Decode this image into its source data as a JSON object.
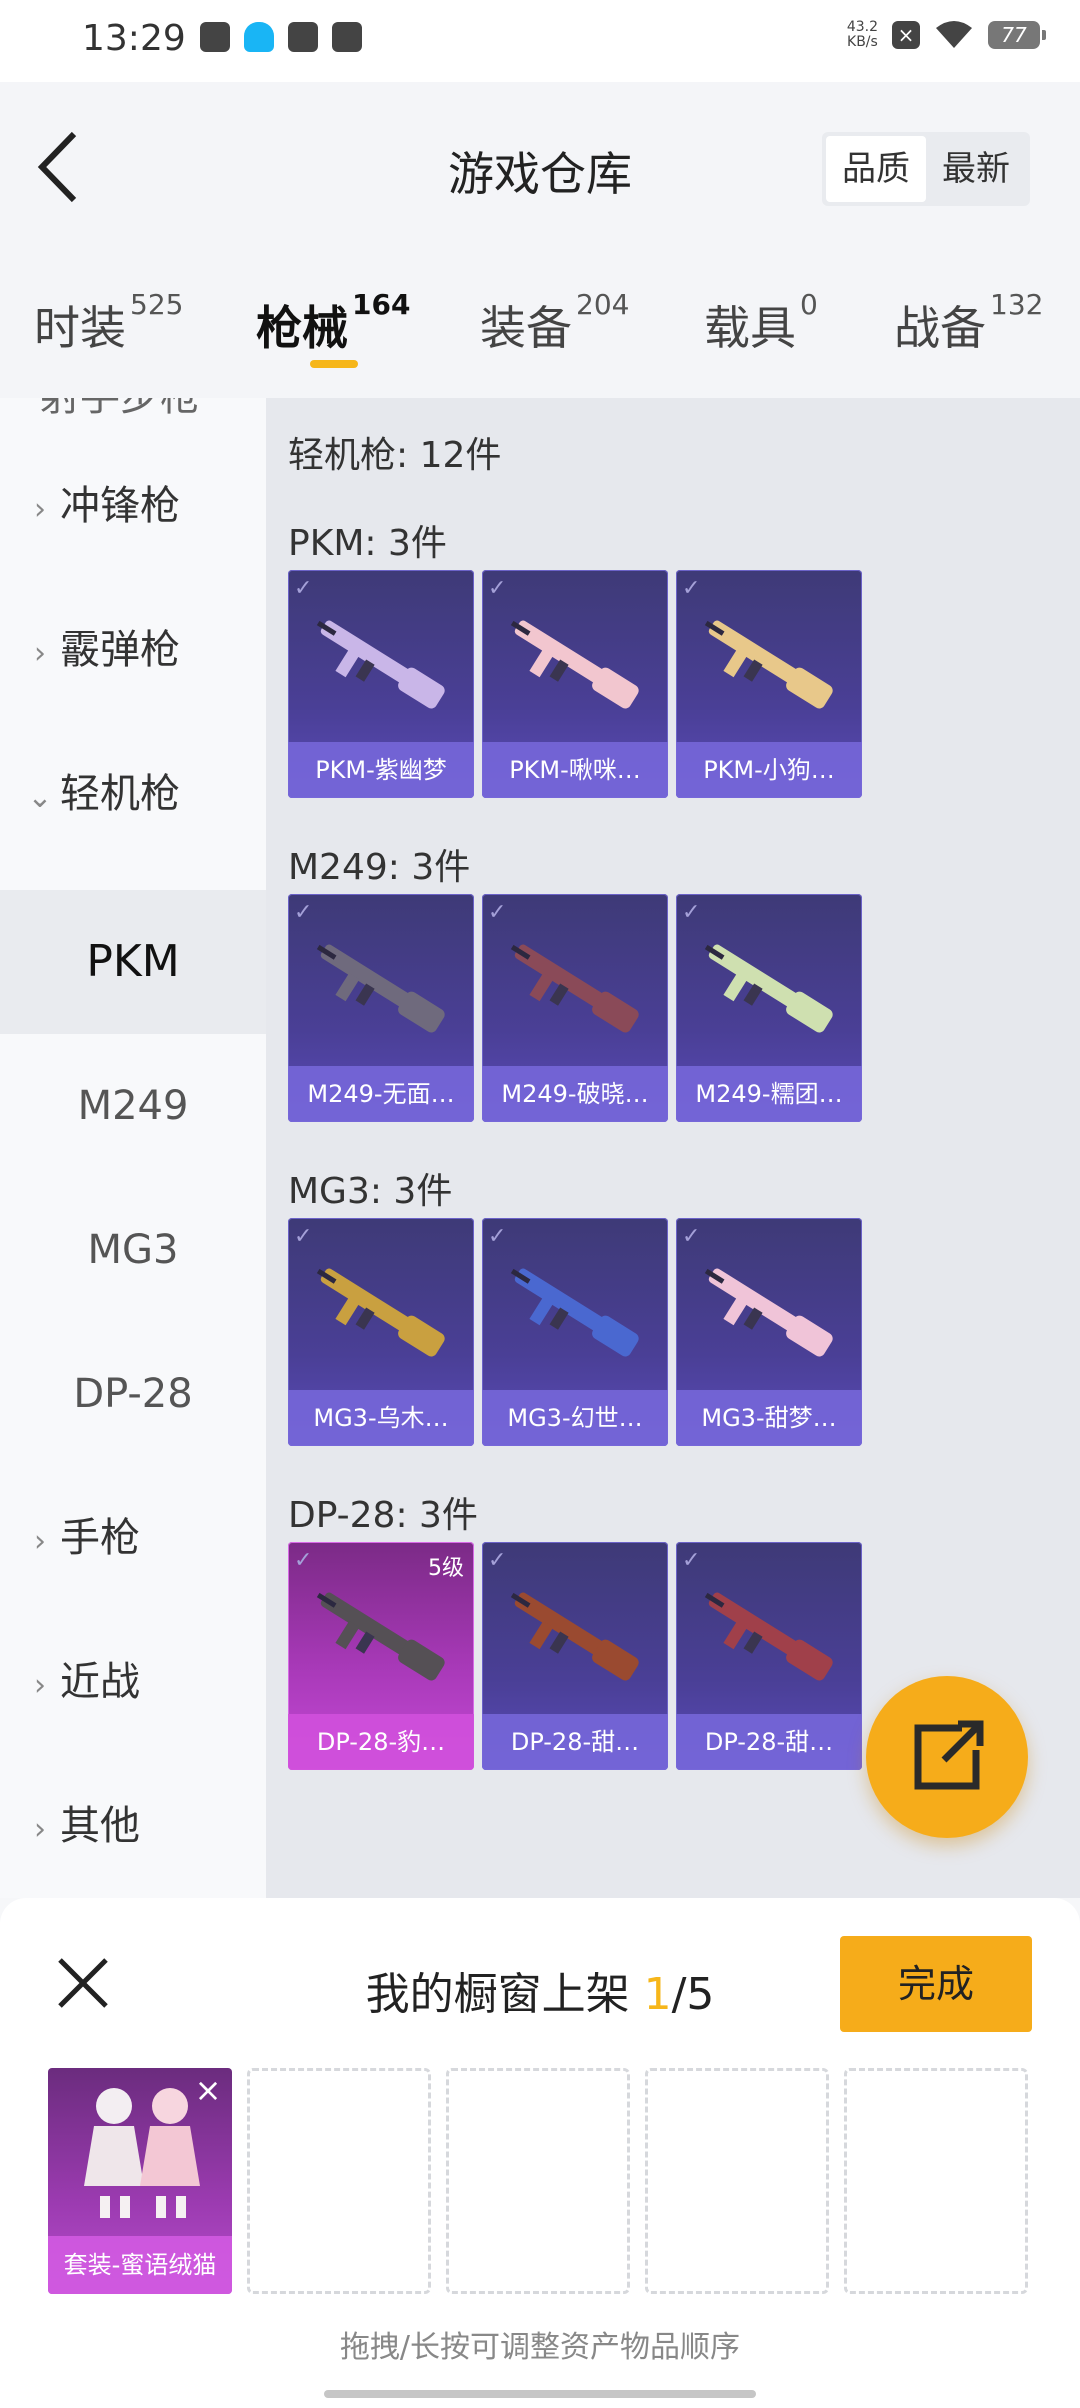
{
  "status_bar": {
    "time": "13:29",
    "net_speed_value": "43.2",
    "net_speed_unit": "KB/s",
    "battery": "77",
    "icons": [
      "gallery-icon",
      "qq-icon",
      "app-icon",
      "mail-icon",
      "close-box-icon",
      "wifi-icon",
      "battery-icon"
    ]
  },
  "header": {
    "title": "游戏仓库",
    "back_icon": "back-arrow-icon",
    "sort_options": [
      "品质",
      "最新"
    ],
    "sort_selected": "品质"
  },
  "tabs": [
    {
      "label": "时装",
      "count": "525"
    },
    {
      "label": "枪械",
      "count": "164",
      "active": true
    },
    {
      "label": "装备",
      "count": "204"
    },
    {
      "label": "载具",
      "count": "0"
    },
    {
      "label": "战备",
      "count": "132"
    }
  ],
  "sidebar": {
    "cut_item": "射手步枪",
    "items": [
      {
        "label": "冲锋枪",
        "type": "category"
      },
      {
        "label": "霰弹枪",
        "type": "category"
      },
      {
        "label": "轻机枪",
        "type": "category",
        "expanded": true
      },
      {
        "label": "PKM",
        "type": "sub",
        "active": true
      },
      {
        "label": "M249",
        "type": "sub"
      },
      {
        "label": "MG3",
        "type": "sub"
      },
      {
        "label": "DP-28",
        "type": "sub"
      },
      {
        "label": "手枪",
        "type": "category"
      },
      {
        "label": "近战",
        "type": "category"
      },
      {
        "label": "其他",
        "type": "category"
      }
    ]
  },
  "content": {
    "summary": "轻机枪: 12件",
    "groups": [
      {
        "title": "PKM: 3件",
        "items": [
          {
            "name": "PKM-紫幽梦",
            "gun_color": "#c9b6e8"
          },
          {
            "name": "PKM-啾咪…",
            "gun_color": "#f2c6cf"
          },
          {
            "name": "PKM-小狗…",
            "gun_color": "#e8c88a"
          }
        ]
      },
      {
        "title": "M249: 3件",
        "items": [
          {
            "name": "M249-无面…",
            "gun_color": "#6f6a7d"
          },
          {
            "name": "M249-破晓…",
            "gun_color": "#8a4a58"
          },
          {
            "name": "M249-糯团…",
            "gun_color": "#cfe0b0"
          }
        ]
      },
      {
        "title": "MG3: 3件",
        "items": [
          {
            "name": "MG3-乌木…",
            "gun_color": "#c9a040"
          },
          {
            "name": "MG3-幻世…",
            "gun_color": "#4a68d0"
          },
          {
            "name": "MG3-甜梦…",
            "gun_color": "#f0c4d8"
          }
        ]
      },
      {
        "title": "DP-28: 3件",
        "items": [
          {
            "name": "DP-28-豹…",
            "gun_color": "#555055",
            "level": "5级",
            "rarity": "pink"
          },
          {
            "name": "DP-28-甜…",
            "gun_color": "#9a4a30"
          },
          {
            "name": "DP-28-甜…",
            "gun_color": "#a0404a"
          }
        ]
      }
    ]
  },
  "fab": {
    "icon": "share-icon",
    "color": "#f6ac1a"
  },
  "sheet": {
    "title_prefix": "我的橱窗上架 ",
    "count_current": "1",
    "count_total": "/5",
    "done_label": "完成",
    "close_icon": "close-icon",
    "slots": [
      {
        "filled": true,
        "label": "套装-蜜语绒猫"
      },
      {
        "filled": false
      },
      {
        "filled": false
      },
      {
        "filled": false
      },
      {
        "filled": false
      }
    ],
    "hint": "拖拽/长按可调整资产物品顺序"
  },
  "colors": {
    "accent": "#f6b61a",
    "card_blue": "#4a3f96",
    "card_pink": "#a839b8"
  }
}
